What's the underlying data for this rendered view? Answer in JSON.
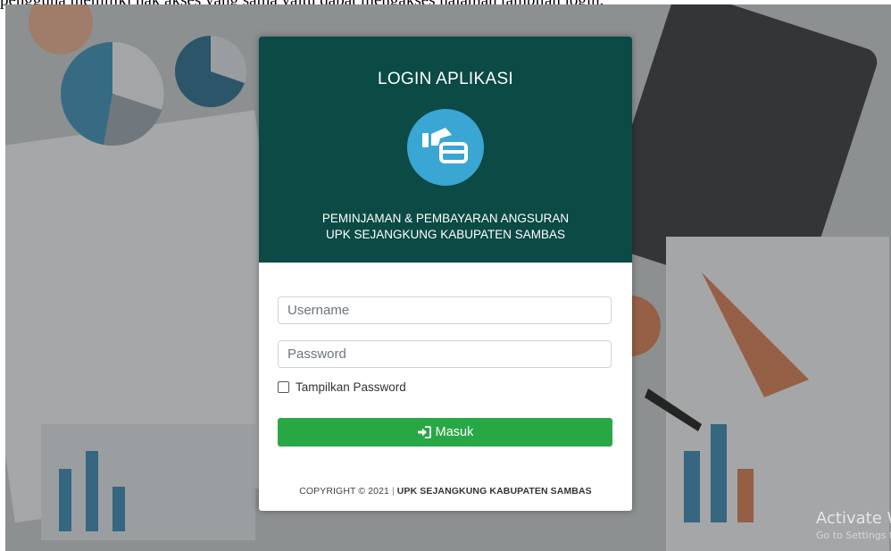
{
  "document": {
    "caption_text": "pengguna memiliki hak akses yang sama yaitu dapat mengakses halaman tampilan login."
  },
  "login_card": {
    "title": "LOGIN APLIKASI",
    "logo_icon": "hand-card-icon",
    "subtitle_line1": "PEMINJAMAN & PEMBAYARAN ANGSURAN",
    "subtitle_line2": "UPK SEJANGKUNG KABUPATEN SAMBAS",
    "header_color": "#0b4a45",
    "logo_color": "#3aa6d4"
  },
  "form": {
    "username_placeholder": "Username",
    "username_value": "",
    "password_placeholder": "Password",
    "password_value": "",
    "show_password_label": "Tampilkan Password",
    "show_password_checked": false,
    "submit_label": "Masuk",
    "submit_icon": "sign-in-icon",
    "submit_color": "#28a745"
  },
  "footer": {
    "copyright": "COPYRIGHT © 2021",
    "separator": "|",
    "organization": "UPK SEJANGKUNG KABUPATEN SAMBAS"
  },
  "watermark": {
    "line1": "Activate Windows",
    "line2": "Go to Settings to activate Windows."
  }
}
